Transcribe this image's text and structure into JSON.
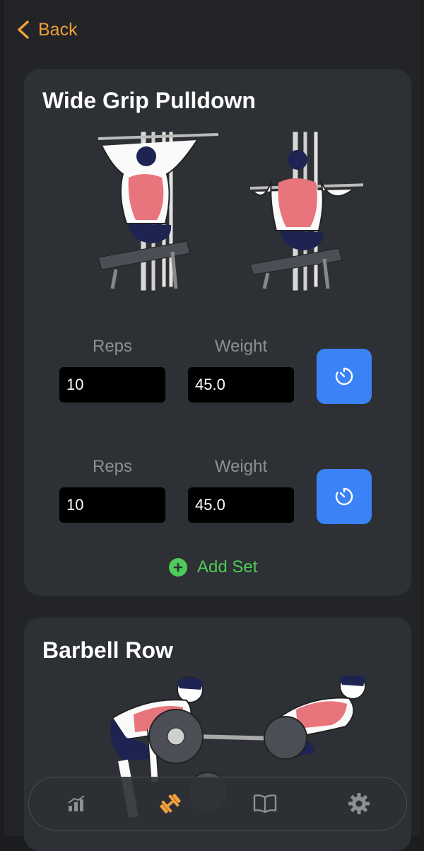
{
  "nav": {
    "back_label": "Back"
  },
  "colors": {
    "accent": "#f0a03a",
    "primary_button": "#3b82f6",
    "add": "#4fcb5a",
    "muscle": "#e8747c"
  },
  "exercises": [
    {
      "title": "Wide Grip Pulldown",
      "sets": [
        {
          "reps_label": "Reps",
          "weight_label": "Weight",
          "reps": "10",
          "weight": "45.0"
        },
        {
          "reps_label": "Reps",
          "weight_label": "Weight",
          "reps": "10",
          "weight": "45.0"
        }
      ],
      "add_set_label": "Add Set"
    },
    {
      "title": "Barbell Row"
    }
  ],
  "tabbar": {
    "items": [
      {
        "icon": "chart-icon",
        "active": false
      },
      {
        "icon": "dumbbell-icon",
        "active": true
      },
      {
        "icon": "book-icon",
        "active": false
      },
      {
        "icon": "gear-icon",
        "active": false
      }
    ]
  }
}
